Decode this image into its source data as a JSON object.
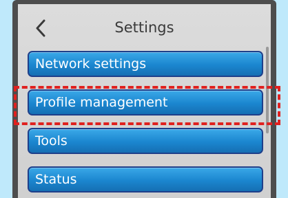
{
  "header": {
    "back_icon": "chevron-left-icon",
    "title": "Settings"
  },
  "menu": {
    "items": [
      {
        "label": "Network settings"
      },
      {
        "label": "Profile management"
      },
      {
        "label": "Tools"
      },
      {
        "label": "Status"
      }
    ]
  },
  "colors": {
    "background": "#bfe9fb",
    "bezel": "#4d4d4d",
    "screen": "#d6d6d6",
    "button": "#1b86cf",
    "button_border": "#1e3f8a",
    "highlight": "#e0211f"
  }
}
